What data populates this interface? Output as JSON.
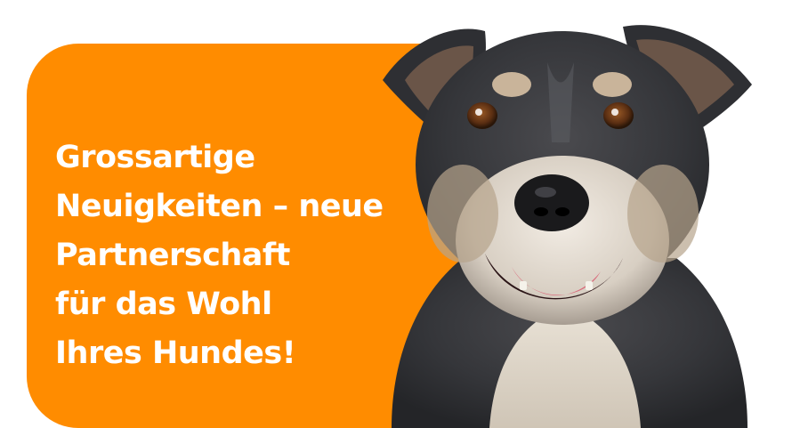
{
  "banner": {
    "headline_lines": [
      "Grossartige",
      "Neuigkeiten – neue",
      "Partnerschaft",
      "für das Wohl",
      "Ihres Hundes!"
    ]
  },
  "colors": {
    "accent": "#FF8C00",
    "text": "#FFFFFF",
    "background": "#FFFFFF"
  },
  "image": {
    "subject": "dog-photo"
  }
}
